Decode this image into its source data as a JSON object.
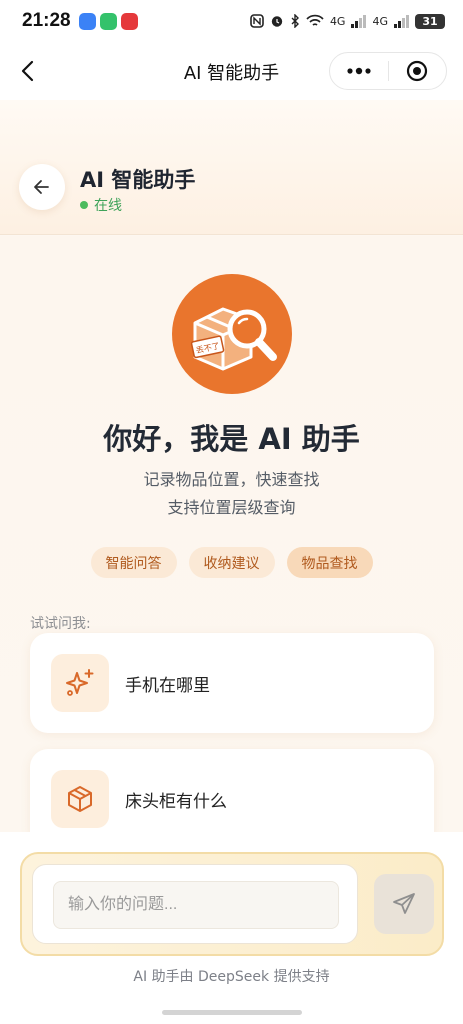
{
  "status": {
    "time": "21:28",
    "net1": "4G",
    "net2": "4G",
    "battery": "31"
  },
  "nav": {
    "title": "AI 智能助手"
  },
  "header": {
    "name": "AI 智能助手",
    "status_text": "在线"
  },
  "hero": {
    "logo_text": "丢不了",
    "greeting": "你好，我是 AI 助手",
    "subtitle1": "记录物品位置，快速查找",
    "subtitle2": "支持位置层级查询"
  },
  "chips": [
    "智能问答",
    "收纳建议",
    "物品查找"
  ],
  "suggestions": {
    "label": "试试问我:",
    "items": [
      {
        "text": "手机在哪里",
        "icon": "sparkle-icon"
      },
      {
        "text": "床头柜有什么",
        "icon": "box-icon"
      }
    ]
  },
  "input": {
    "placeholder": "输入你的问题..."
  },
  "footer": {
    "powered_by": "AI 助手由 DeepSeek 提供支持"
  },
  "colors": {
    "accent": "#e9752d",
    "online": "#4cbb5e",
    "chip_text": "#b05a1e"
  }
}
